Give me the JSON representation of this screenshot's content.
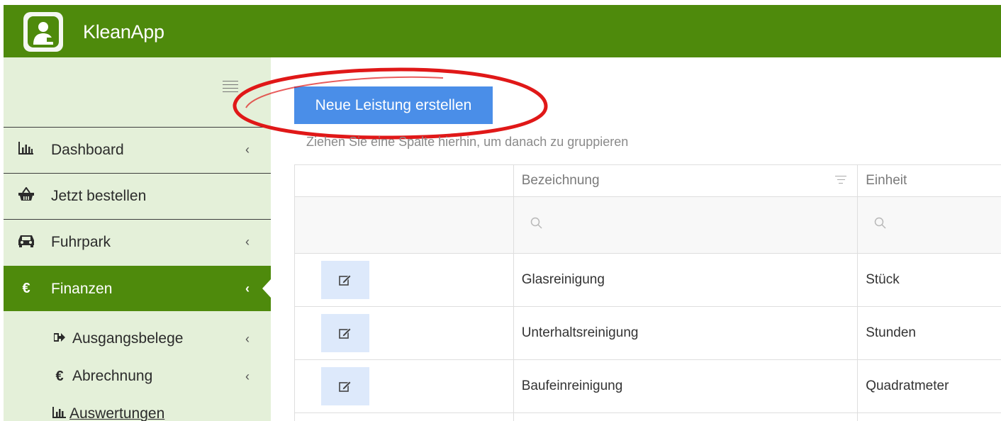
{
  "header": {
    "app_title": "KleanApp",
    "logo_icon": "user-clean-icon",
    "bg_color": "#4e8a0c"
  },
  "sidebar": {
    "toggle_icon": "hamburger-icon",
    "items": [
      {
        "label": "Dashboard",
        "icon": "bar-chart-icon",
        "chevron": "‹"
      },
      {
        "label": "Jetzt bestellen",
        "icon": "basket-icon",
        "chevron": ""
      },
      {
        "label": "Fuhrpark",
        "icon": "car-icon",
        "chevron": "‹"
      },
      {
        "label": "Finanzen",
        "icon": "euro-icon",
        "chevron": "‹",
        "active": true
      }
    ],
    "sub_items": [
      {
        "label": "Ausgangsbelege",
        "icon": "sign-out-icon",
        "chevron": "‹"
      },
      {
        "label": "Abrechnung",
        "icon": "euro-icon",
        "chevron": "‹"
      },
      {
        "label": "Auswertungen",
        "icon": "bar-chart-icon",
        "chevron": ""
      }
    ]
  },
  "main": {
    "new_button_label": "Neue Leistung erstellen",
    "group_hint": "Ziehen Sie eine Spalte hierhin, um danach zu gruppieren",
    "columns": [
      "",
      "Bezeichnung",
      "Einheit"
    ],
    "rows": [
      {
        "bezeichnung": "Glasreinigung",
        "einheit": "Stück"
      },
      {
        "bezeichnung": "Unterhaltsreinigung",
        "einheit": "Stunden"
      },
      {
        "bezeichnung": "Baufeinreinigung",
        "einheit": "Quadratmeter"
      }
    ]
  },
  "colors": {
    "brand_green": "#4e8a0c",
    "sidebar_bg": "#e4f0d9",
    "button_blue": "#4a8ee8",
    "highlight_red": "#e01818"
  }
}
